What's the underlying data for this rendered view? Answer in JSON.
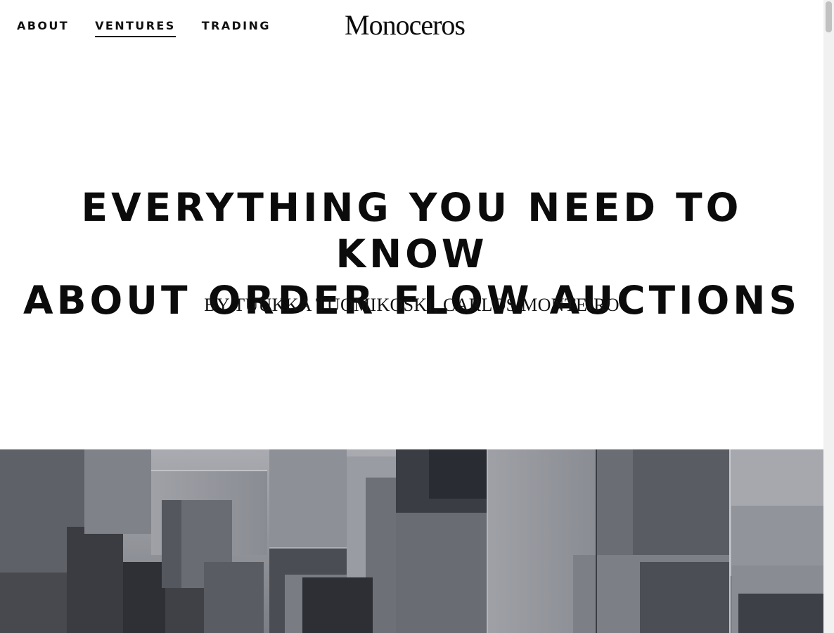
{
  "nav": {
    "about": "ABOUT",
    "ventures": "VENTURES",
    "trading": "TRADING"
  },
  "brand": {
    "logo": "Monoceros"
  },
  "article": {
    "title_line1": "EVERYTHING YOU NEED TO KNOW",
    "title_line2": "ABOUT ORDER FLOW AUCTIONS",
    "byline": "BY TUUKKA TUOMIKOSKI, CARLOS MONTEIRO"
  },
  "colors": {
    "text": "#0b0b0b",
    "background": "#ffffff",
    "concrete": "#6d6f75"
  }
}
